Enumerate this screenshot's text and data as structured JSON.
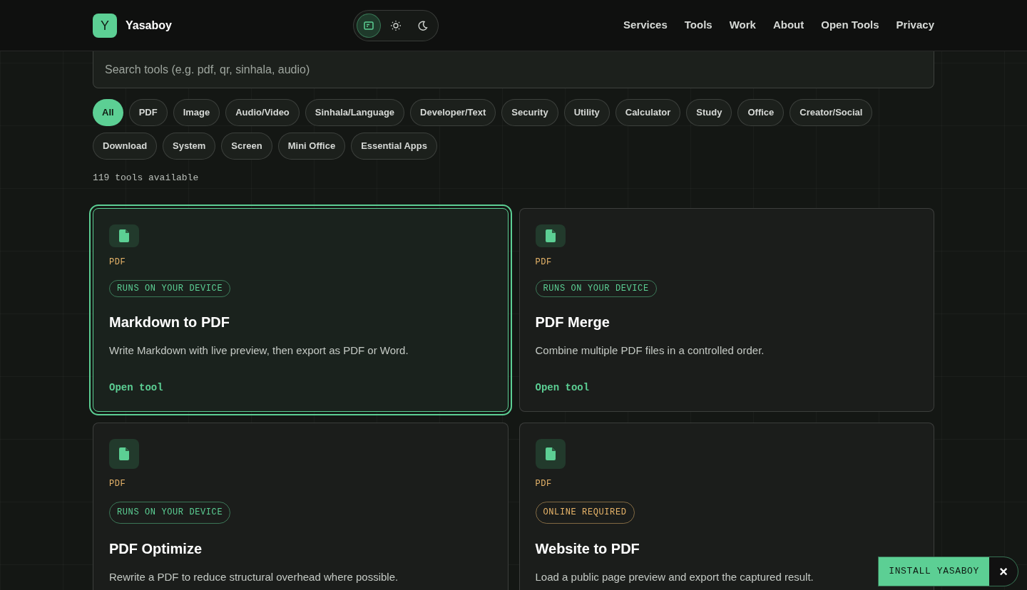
{
  "brand": {
    "logo_letter": "Y",
    "name": "Yasaboy"
  },
  "theme_toggle": [
    {
      "kind": "system",
      "selected": true
    },
    {
      "kind": "light",
      "selected": false
    },
    {
      "kind": "dark",
      "selected": false
    }
  ],
  "nav": [
    "Services",
    "Tools",
    "Work",
    "About",
    "Open Tools",
    "Privacy"
  ],
  "search": {
    "placeholder": "Search tools (e.g. pdf, qr, sinhala, audio)"
  },
  "filters": [
    {
      "label": "All",
      "selected": true
    },
    {
      "label": "PDF",
      "selected": false
    },
    {
      "label": "Image",
      "selected": false
    },
    {
      "label": "Audio/Video",
      "selected": false
    },
    {
      "label": "Sinhala/Language",
      "selected": false
    },
    {
      "label": "Developer/Text",
      "selected": false
    },
    {
      "label": "Security",
      "selected": false
    },
    {
      "label": "Utility",
      "selected": false
    },
    {
      "label": "Calculator",
      "selected": false
    },
    {
      "label": "Study",
      "selected": false
    },
    {
      "label": "Office",
      "selected": false
    },
    {
      "label": "Creator/Social",
      "selected": false
    },
    {
      "label": "Download",
      "selected": false
    },
    {
      "label": "System",
      "selected": false
    },
    {
      "label": "Screen",
      "selected": false
    },
    {
      "label": "Mini Office",
      "selected": false
    },
    {
      "label": "Essential Apps",
      "selected": false
    }
  ],
  "count": "119 tools available",
  "cards": [
    {
      "category": "PDF",
      "badge": {
        "kind": "local",
        "text": "RUNS ON YOUR DEVICE"
      },
      "title": "Markdown to PDF",
      "description": "Write Markdown with live preview, then export as PDF or Word.",
      "link": "Open tool",
      "selected": true
    },
    {
      "category": "PDF",
      "badge": {
        "kind": "local",
        "text": "RUNS ON YOUR DEVICE"
      },
      "title": "PDF Merge",
      "description": "Combine multiple PDF files in a controlled order.",
      "link": "Open tool",
      "selected": false
    },
    {
      "category": "PDF",
      "badge": {
        "kind": "local",
        "text": "RUNS ON YOUR DEVICE"
      },
      "title": "PDF Optimize",
      "description": "Rewrite a PDF to reduce structural overhead where possible.",
      "selected": false
    },
    {
      "category": "PDF",
      "badge": {
        "kind": "online",
        "text": "ONLINE REQUIRED"
      },
      "title": "Website to PDF",
      "description": "Load a public page preview and export the captured result.",
      "selected": false
    }
  ],
  "install": {
    "label": "INSTALL YASABOY",
    "close": "×"
  }
}
